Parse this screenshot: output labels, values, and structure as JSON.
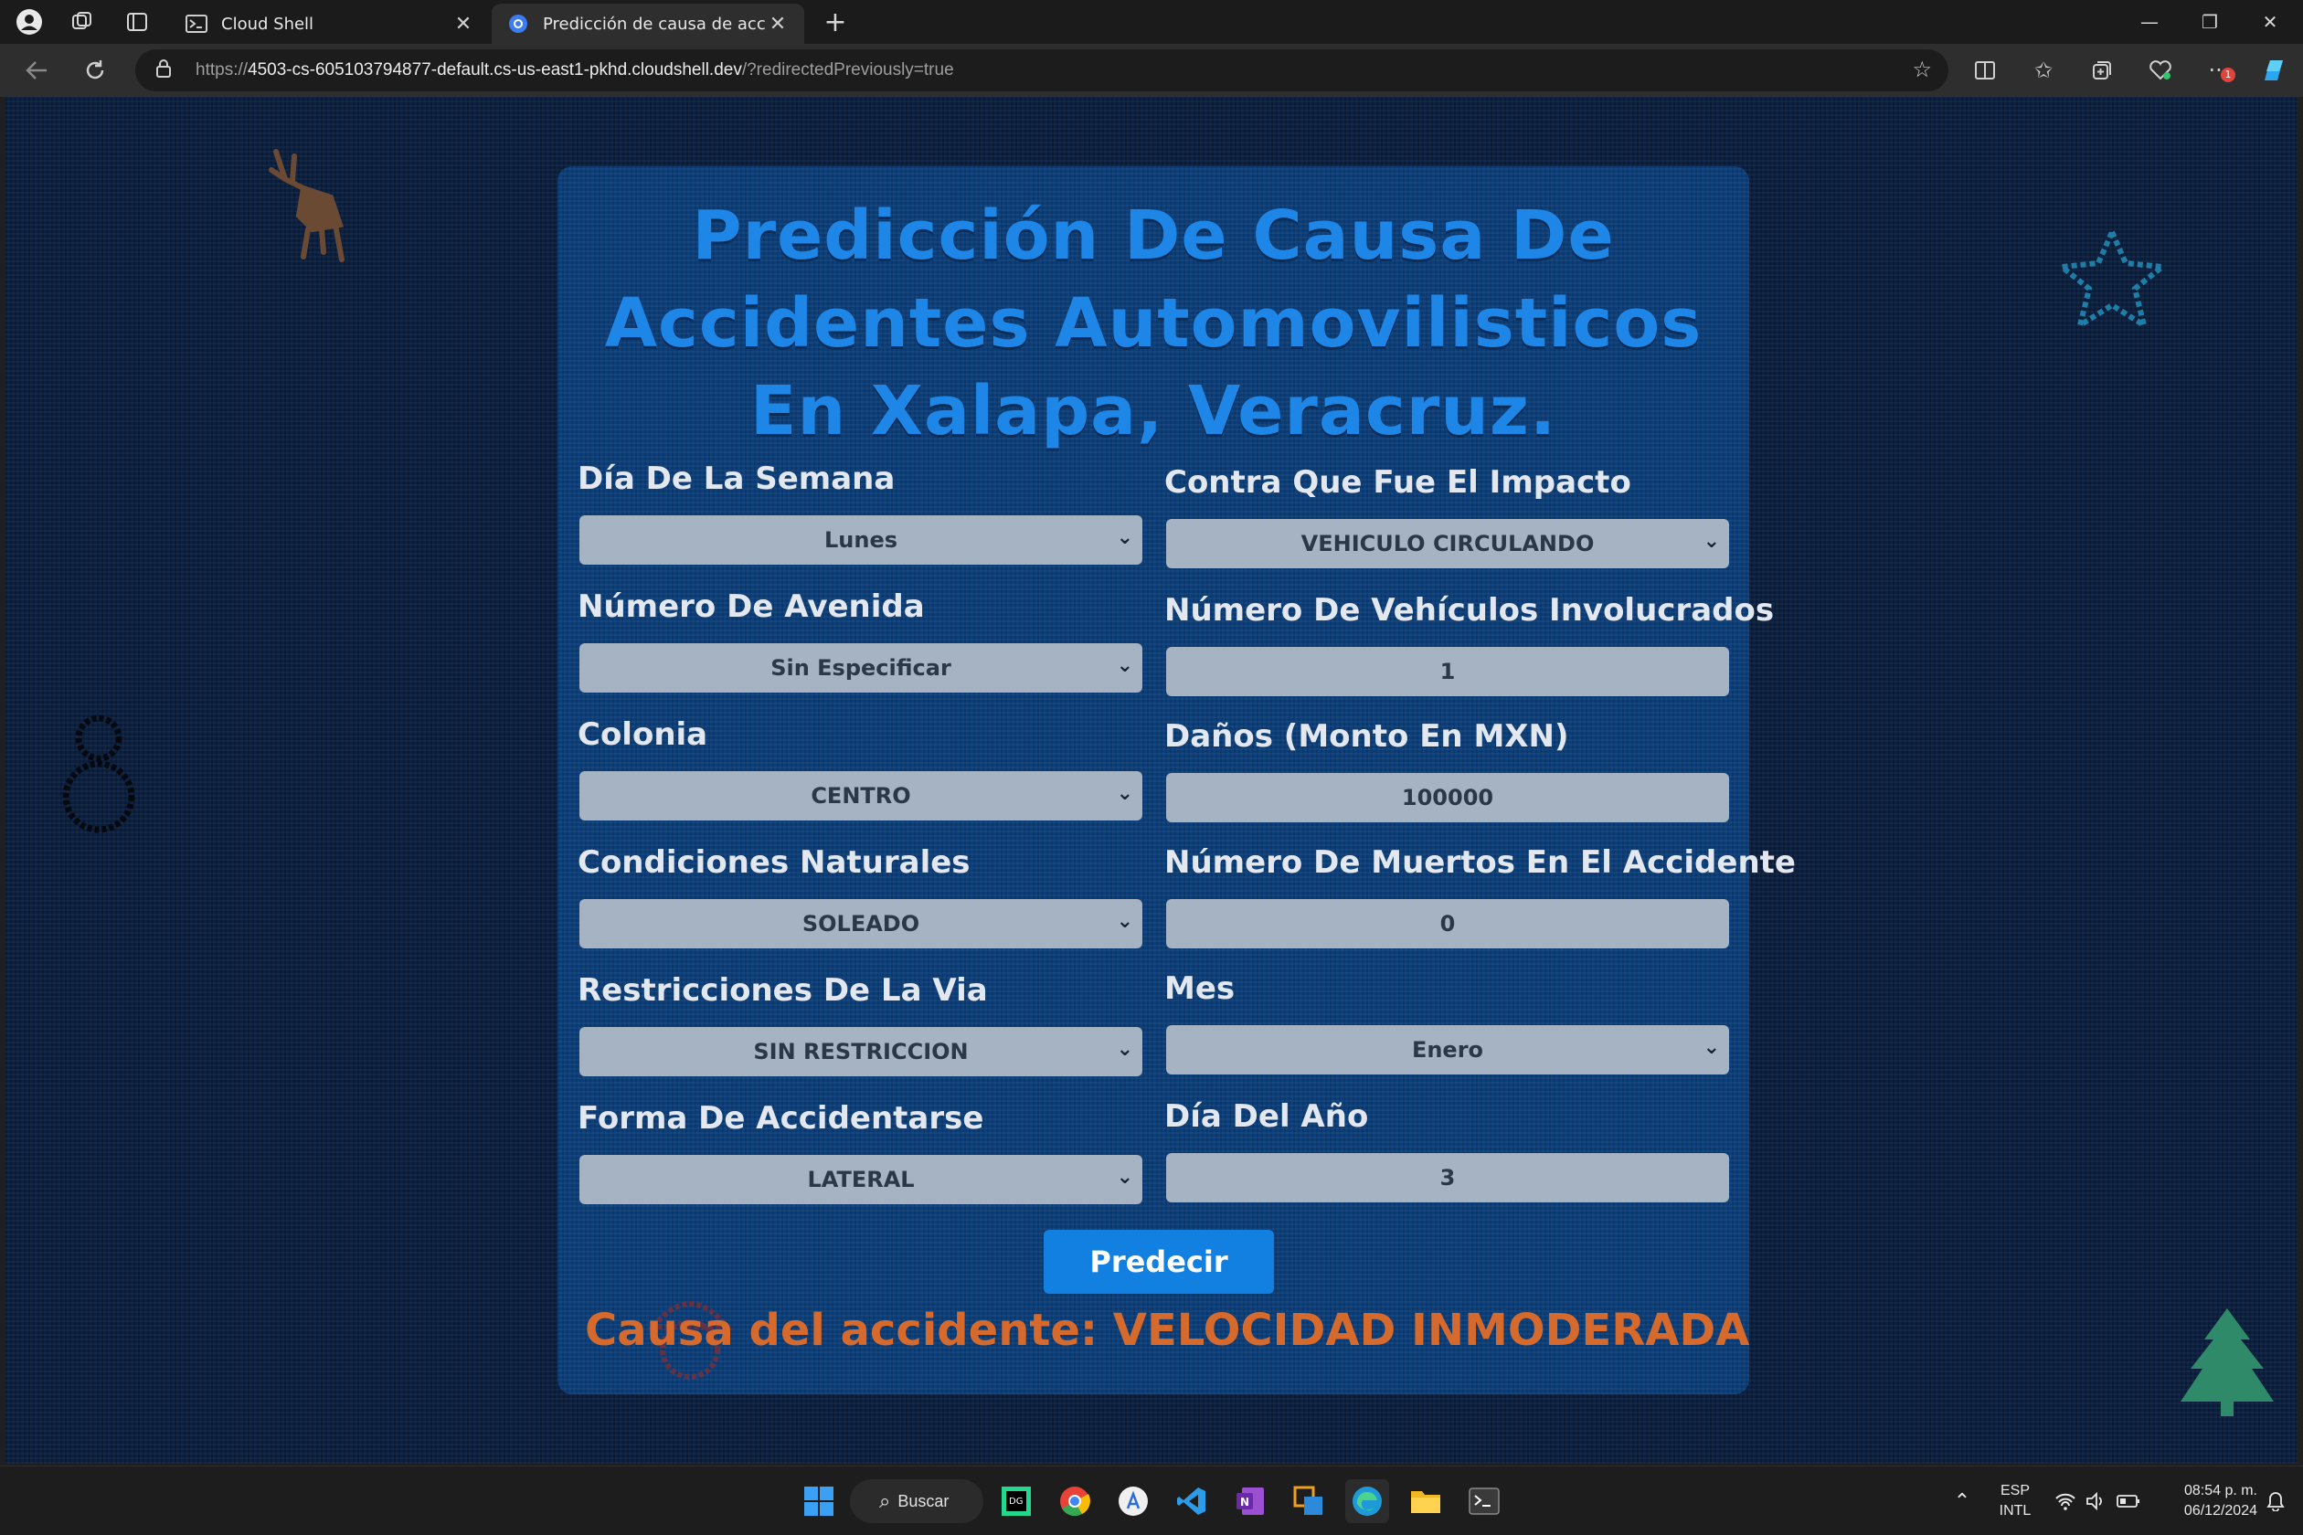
{
  "browser": {
    "tabs": [
      {
        "title": "Cloud Shell",
        "icon": "terminal-icon",
        "active": false
      },
      {
        "title": "Predicción de causa de accidentes",
        "icon": "cloud-app-icon",
        "active": true
      }
    ],
    "url_prefix": "https://",
    "url_host": "4503-cs-605103794877-default.cs-us-east1-pkhd.cloudshell.dev",
    "url_path": "/?redirectedPreviously=true",
    "notification_badge": "1"
  },
  "page": {
    "title": "Predicción De Causa De Accidentes Automovilisticos En Xalapa, Veracruz.",
    "fields_left": [
      {
        "label": "Día De La Semana",
        "value": "Lunes",
        "type": "select"
      },
      {
        "label": "Número De Avenida",
        "value": "Sin Especificar",
        "type": "select"
      },
      {
        "label": "Colonia",
        "value": "CENTRO",
        "type": "select"
      },
      {
        "label": "Condiciones Naturales",
        "value": "SOLEADO",
        "type": "select"
      },
      {
        "label": "Restricciones De La Via",
        "value": "SIN RESTRICCION",
        "type": "select"
      },
      {
        "label": "Forma De Accidentarse",
        "value": "LATERAL",
        "type": "select"
      }
    ],
    "fields_right": [
      {
        "label": "Contra Que Fue El Impacto",
        "value": "VEHICULO CIRCULANDO",
        "type": "select"
      },
      {
        "label": "Número De Vehículos Involucrados",
        "value": "1",
        "type": "input"
      },
      {
        "label": "Daños (Monto En MXN)",
        "value": "100000",
        "type": "input"
      },
      {
        "label": "Número De Muertos En El Accidente",
        "value": "0",
        "type": "input"
      },
      {
        "label": "Mes",
        "value": "Enero",
        "type": "select"
      },
      {
        "label": "Día Del Año",
        "value": "3",
        "type": "input"
      }
    ],
    "predict_button": "Predecir",
    "result_label": "Causa del accidente:",
    "result_value": "VELOCIDAD INMODERADA"
  },
  "taskbar": {
    "search_label": "Buscar",
    "lang_top": "ESP",
    "lang_bottom": "INTL",
    "time": "08:54 p. m.",
    "date": "06/12/2024"
  },
  "colors": {
    "page_bg": "#0c2040",
    "card_bg": "#0c3f7a",
    "title": "#1e86e6",
    "button": "#1280e0",
    "result": "#d66a2c"
  }
}
